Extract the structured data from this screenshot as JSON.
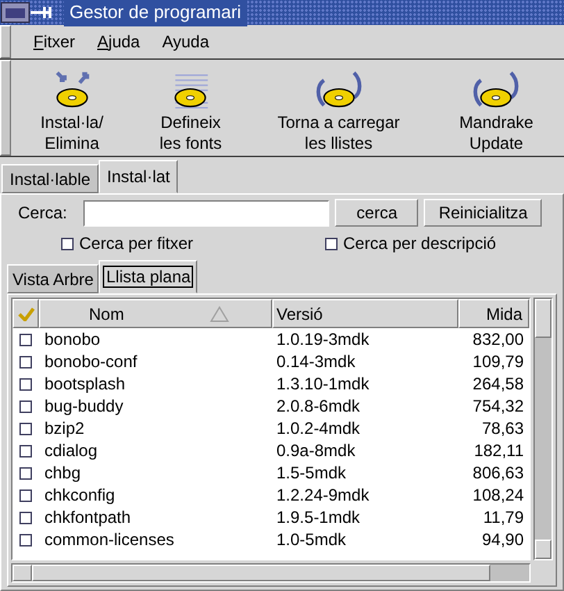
{
  "window": {
    "title": "Gestor de programari"
  },
  "menu": [
    {
      "label": "Fitxer",
      "mnemonic": true
    },
    {
      "label": "Ajuda",
      "mnemonic": true
    },
    {
      "label": "Ayuda",
      "mnemonic": false
    }
  ],
  "toolbar": [
    {
      "kind": "install",
      "label": "Instal·la/ Elimina"
    },
    {
      "kind": "sources",
      "label": "Defineix les fonts"
    },
    {
      "kind": "reload",
      "label": "Torna a carregar les llistes"
    },
    {
      "kind": "update",
      "label": "Mandrake Update"
    }
  ],
  "tabs": [
    {
      "label": "Instal·lable",
      "selected": false
    },
    {
      "label": "Instal·lat",
      "selected": true
    }
  ],
  "search": {
    "label": "Cerca:",
    "button": "cerca",
    "reset": "Reinicialitza"
  },
  "options": [
    {
      "label": "Cerca per fitxer",
      "checked": false
    },
    {
      "label": "Cerca per descripció",
      "checked": false
    }
  ],
  "view_tabs": [
    {
      "label": "Vista Arbre",
      "selected": false
    },
    {
      "label": "Llista plana",
      "selected": true
    }
  ],
  "table": {
    "columns": [
      "Nom",
      "Versió",
      "Mida"
    ],
    "rows": [
      {
        "checked": false,
        "name": "bonobo",
        "version": "1.0.19-3mdk",
        "size": "832,00"
      },
      {
        "checked": false,
        "name": "bonobo-conf",
        "version": "0.14-3mdk",
        "size": "109,79"
      },
      {
        "checked": false,
        "name": "bootsplash",
        "version": "1.3.10-1mdk",
        "size": "264,58"
      },
      {
        "checked": false,
        "name": "bug-buddy",
        "version": "2.0.8-6mdk",
        "size": "754,32"
      },
      {
        "checked": false,
        "name": "bzip2",
        "version": "1.0.2-4mdk",
        "size": "78,63"
      },
      {
        "checked": false,
        "name": "cdialog",
        "version": "0.9a-8mdk",
        "size": "182,11"
      },
      {
        "checked": false,
        "name": "chbg",
        "version": "1.5-5mdk",
        "size": "806,63"
      },
      {
        "checked": false,
        "name": "chkconfig",
        "version": "1.2.24-9mdk",
        "size": "108,24"
      },
      {
        "checked": false,
        "name": "chkfontpath",
        "version": "1.9.5-1mdk",
        "size": "11,79"
      },
      {
        "checked": false,
        "name": "common-licenses",
        "version": "1.0-5mdk",
        "size": "94,90"
      }
    ]
  }
}
